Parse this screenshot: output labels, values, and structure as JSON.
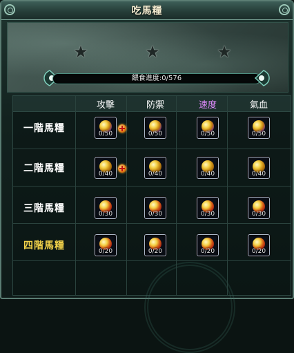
{
  "window": {
    "title": "吃馬糧"
  },
  "progress": {
    "label": "餵食進度:0/576",
    "current": 0,
    "max": 576
  },
  "columns": [
    {
      "label": "攻擊",
      "color": "#ffffff"
    },
    {
      "label": "防禦",
      "color": "#ffffff"
    },
    {
      "label": "速度",
      "color": "#e28cff"
    },
    {
      "label": "氣血",
      "color": "#ffffff"
    }
  ],
  "rows": [
    {
      "label": "一階馬糧",
      "color": "#ffffff",
      "gem": "purple",
      "show_plus": true,
      "cells": [
        "0/50",
        "0/50",
        "0/50",
        "0/50"
      ]
    },
    {
      "label": "二階馬糧",
      "color": "#ffffff",
      "gem": "gold",
      "show_plus": true,
      "cells": [
        "0/40",
        "0/40",
        "0/40",
        "0/40"
      ]
    },
    {
      "label": "三階馬糧",
      "color": "#ffffff",
      "gem": "red",
      "show_plus": false,
      "cells": [
        "0/30",
        "0/30",
        "0/30",
        "0/30"
      ]
    },
    {
      "label": "四階馬糧",
      "color": "#f2d24a",
      "gem": "red",
      "show_plus": false,
      "cells": [
        "0/20",
        "0/20",
        "0/20",
        "0/20"
      ]
    }
  ],
  "icons": {
    "star": "star-icon",
    "plus": "plus-icon",
    "feed_item": "horse-feed-icon"
  }
}
